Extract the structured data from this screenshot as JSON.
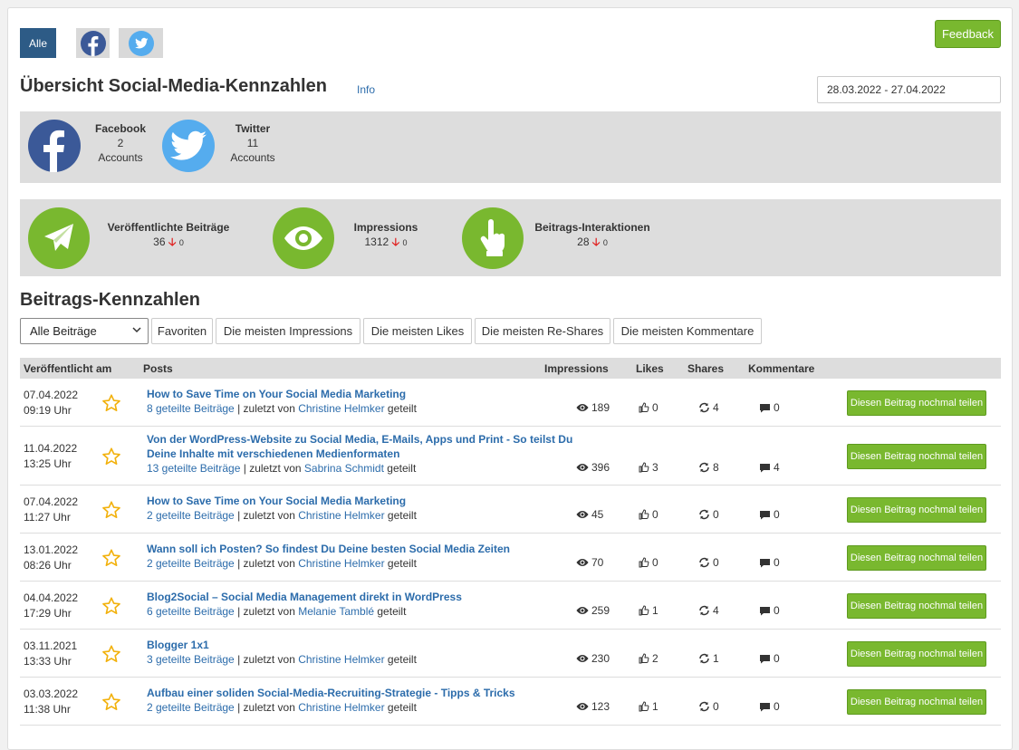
{
  "network_filter": {
    "all_label": "Alle",
    "facebook_icon": "facebook-icon",
    "twitter_icon": "twitter-icon"
  },
  "feedback_label": "Feedback",
  "title": "Übersicht Social-Media-Kennzahlen",
  "info_label": "Info",
  "date_range": "28.03.2022 - 27.04.2022",
  "accounts": [
    {
      "network": "Facebook",
      "count": "2",
      "unit": "Accounts",
      "icon": "facebook-icon",
      "color": "#3b5998"
    },
    {
      "network": "Twitter",
      "count": "11",
      "unit": "Accounts",
      "icon": "twitter-icon",
      "color": "#55acee"
    }
  ],
  "metrics": [
    {
      "label": "Veröffentlichte Beiträge",
      "value": "36",
      "delta": "0",
      "icon": "paper-plane-icon"
    },
    {
      "label": "Impressions",
      "value": "1312",
      "delta": "0",
      "icon": "eye-icon"
    },
    {
      "label": "Beitrags-Interaktionen",
      "value": "28",
      "delta": "0",
      "icon": "pointing-hand-icon"
    }
  ],
  "section_title": "Beitrags-Kennzahlen",
  "filters": {
    "select_value": "Alle Beiträge",
    "buttons": [
      "Favoriten",
      "Die meisten Impressions",
      "Die meisten Likes",
      "Die meisten Re-Shares",
      "Die meisten Kommentare"
    ]
  },
  "table": {
    "headers": {
      "published": "Veröffentlicht am",
      "posts": "Posts",
      "impressions": "Impressions",
      "likes": "Likes",
      "shares": "Shares",
      "comments": "Kommentare"
    },
    "reshare_label": "Diesen Beitrag nochmal teilen",
    "rows": [
      {
        "date": "07.04.2022",
        "time": "09:19 Uhr",
        "title": "How to Save Time on Your Social Media Marketing",
        "shared": "8 geteilte Beiträge",
        "by_prefix": " | zuletzt von ",
        "author": "Christine Helmker",
        "by_suffix": " geteilt",
        "impressions": "189",
        "likes": "0",
        "shares": "4",
        "comments": "0"
      },
      {
        "date": "11.04.2022",
        "time": "13:25 Uhr",
        "title": "Von der WordPress-Website zu Social Media, E-Mails, Apps und Print - So teilst Du Deine Inhalte mit verschiedenen Medienformaten",
        "shared": "13 geteilte Beiträge",
        "by_prefix": " | zuletzt von ",
        "author": "Sabrina Schmidt",
        "by_suffix": " geteilt",
        "impressions": "396",
        "likes": "3",
        "shares": "8",
        "comments": "4"
      },
      {
        "date": "07.04.2022",
        "time": "11:27 Uhr",
        "title": "How to Save Time on Your Social Media Marketing",
        "shared": "2 geteilte Beiträge",
        "by_prefix": " | zuletzt von ",
        "author": "Christine Helmker",
        "by_suffix": " geteilt",
        "impressions": "45",
        "likes": "0",
        "shares": "0",
        "comments": "0"
      },
      {
        "date": "13.01.2022",
        "time": "08:26 Uhr",
        "title": "Wann soll ich Posten? So findest Du Deine besten Social Media Zeiten",
        "shared": "2 geteilte Beiträge",
        "by_prefix": " | zuletzt von ",
        "author": "Christine Helmker",
        "by_suffix": " geteilt",
        "impressions": "70",
        "likes": "0",
        "shares": "0",
        "comments": "0"
      },
      {
        "date": "04.04.2022",
        "time": "17:29 Uhr",
        "title": "Blog2Social – Social Media Management direkt in WordPress",
        "shared": "6 geteilte Beiträge",
        "by_prefix": " | zuletzt von ",
        "author": "Melanie Tamblé",
        "by_suffix": " geteilt",
        "impressions": "259",
        "likes": "1",
        "shares": "4",
        "comments": "0"
      },
      {
        "date": "03.11.2021",
        "time": "13:33 Uhr",
        "title": "Blogger 1x1",
        "shared": "3 geteilte Beiträge",
        "by_prefix": " | zuletzt von ",
        "author": "Christine Helmker",
        "by_suffix": " geteilt",
        "impressions": "230",
        "likes": "2",
        "shares": "1",
        "comments": "0"
      },
      {
        "date": "03.03.2022",
        "time": "11:38 Uhr",
        "title": "Aufbau einer soliden Social-Media-Recruiting-Strategie - Tipps & Tricks",
        "shared": "2 geteilte Beiträge",
        "by_prefix": " | zuletzt von ",
        "author": "Christine Helmker",
        "by_suffix": " geteilt",
        "impressions": "123",
        "likes": "1",
        "shares": "0",
        "comments": "0"
      }
    ]
  }
}
